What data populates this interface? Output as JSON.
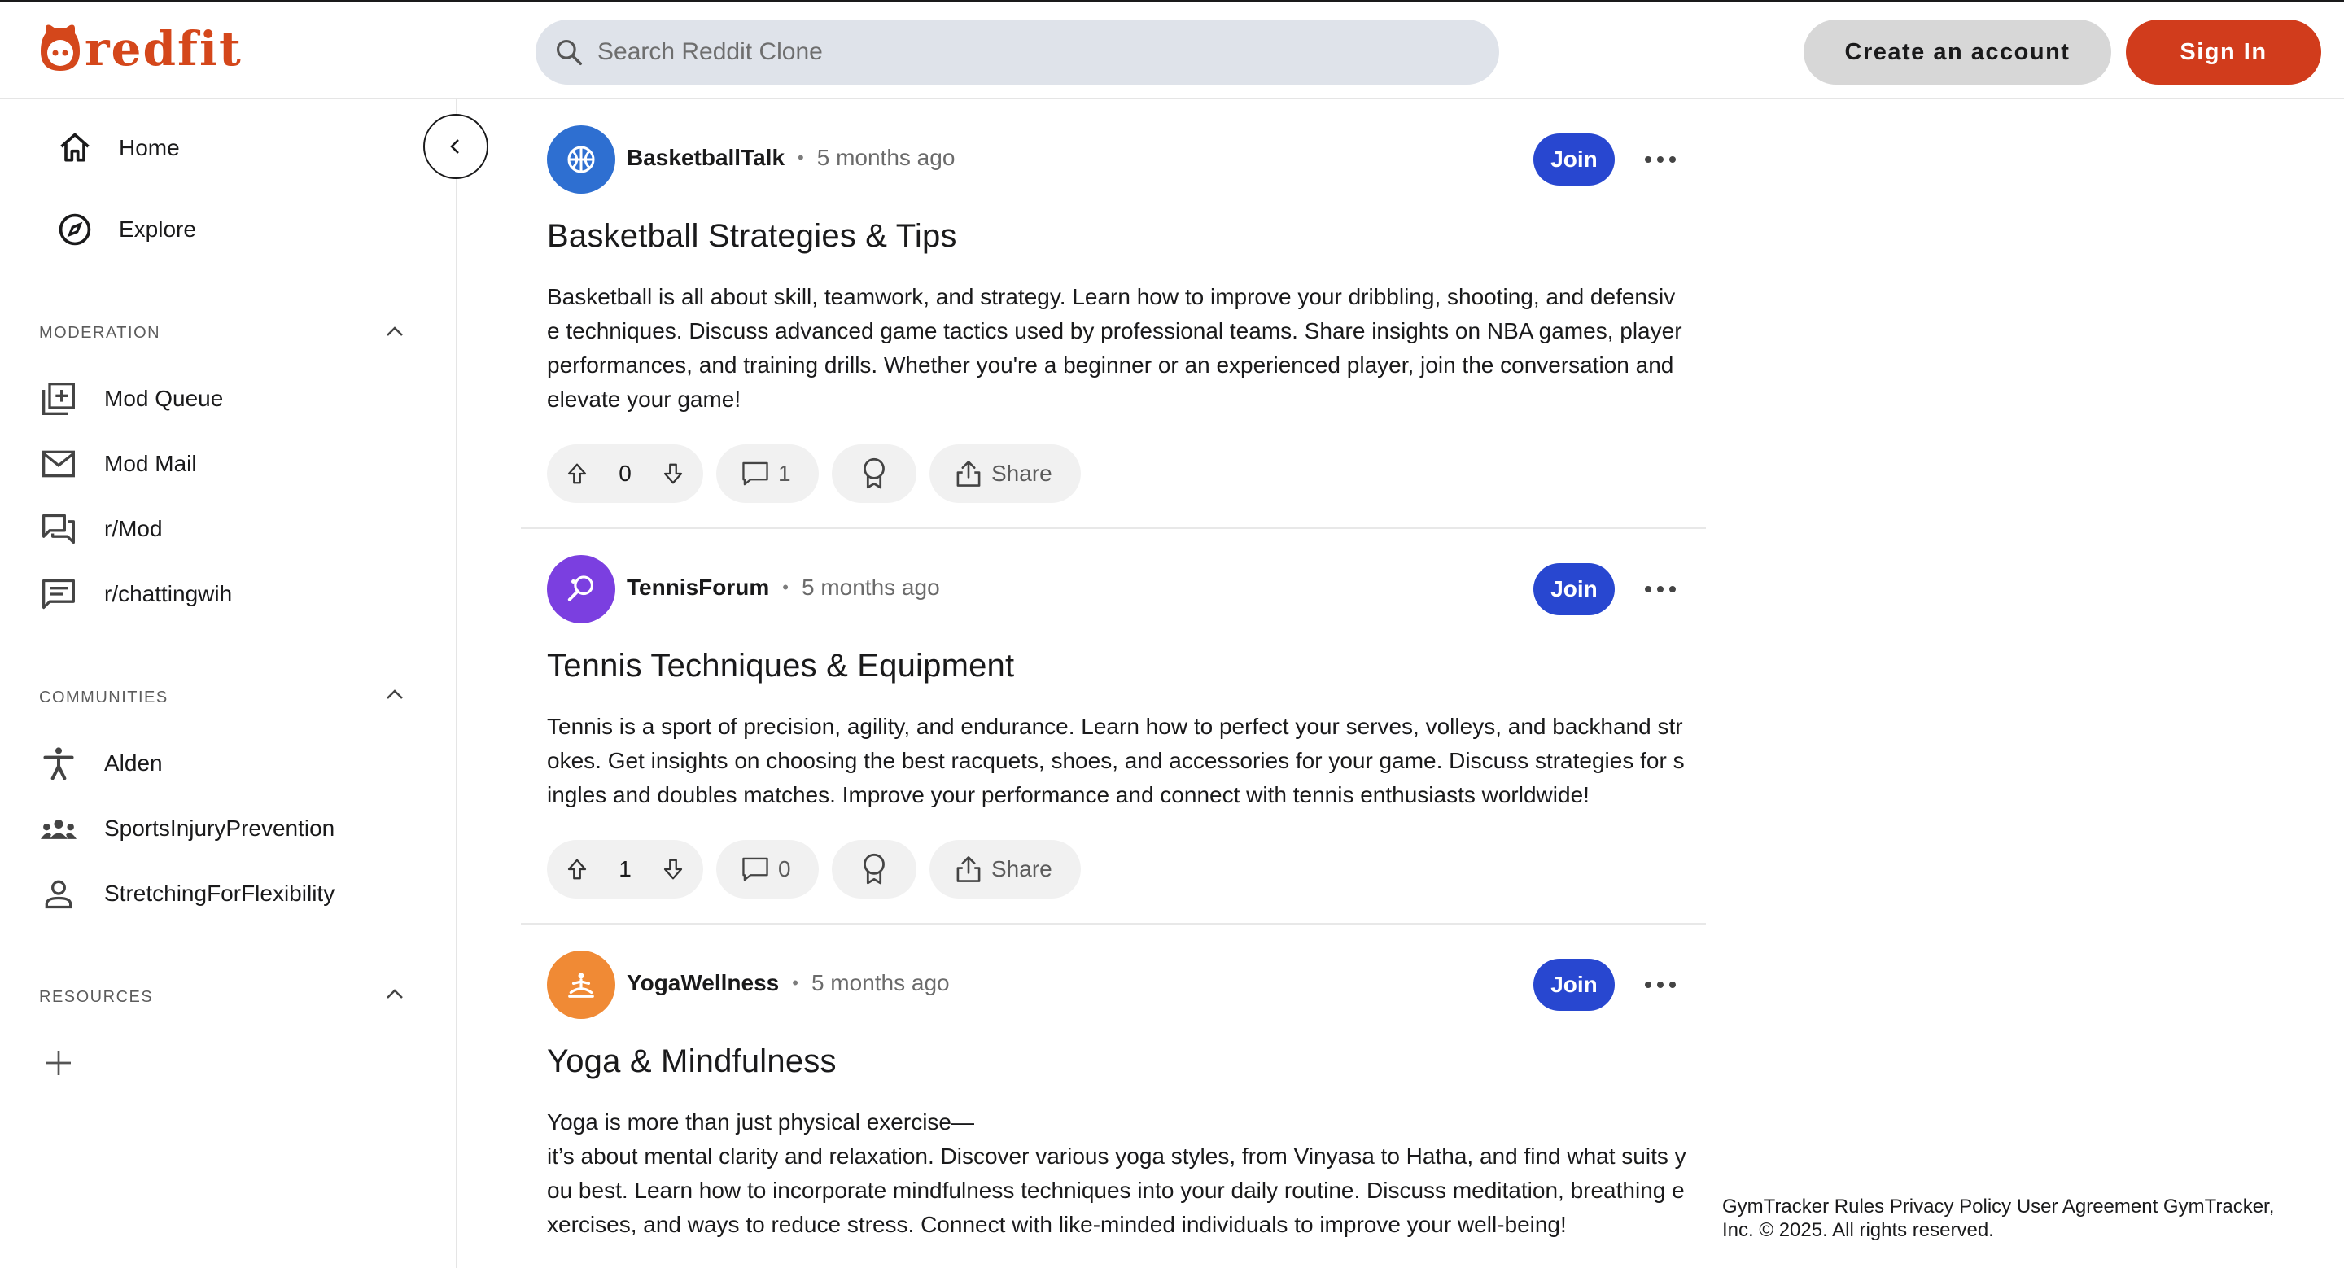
{
  "brand": {
    "name": "redfit",
    "color": "#d4471b"
  },
  "search": {
    "placeholder": "Search Reddit Clone"
  },
  "header": {
    "create_account": "Create an account",
    "sign_in": "Sign In"
  },
  "nav": [
    {
      "label": "Home",
      "icon": "home-icon"
    },
    {
      "label": "Explore",
      "icon": "compass-icon"
    }
  ],
  "moderation": {
    "title": "MODERATION",
    "items": [
      {
        "label": "Mod Queue",
        "icon": "mod-queue-icon"
      },
      {
        "label": "Mod Mail",
        "icon": "mail-icon"
      },
      {
        "label": "r/Mod",
        "icon": "forum-icon"
      },
      {
        "label": "r/chattingwih",
        "icon": "chat-icon"
      }
    ]
  },
  "communities": {
    "title": "COMMUNITIES",
    "items": [
      {
        "label": "Alden",
        "icon": "accessibility-icon"
      },
      {
        "label": "SportsInjuryPrevention",
        "icon": "group-icon"
      },
      {
        "label": "StretchingForFlexibility",
        "icon": "person-icon"
      }
    ]
  },
  "resources": {
    "title": "RESOURCES"
  },
  "posts": [
    {
      "community": "BasketballTalk",
      "time": "5 months ago",
      "avatar_color": "#2e6fd1",
      "join": "Join",
      "title": "Basketball Strategies & Tips",
      "body": "Basketball is all about skill, teamwork, and strategy. Learn how to improve your dribbling, shooting, and defensive techniques. Discuss advanced game tactics used by professional teams. Share insights on NBA games, player performances, and training drills. Whether you're a beginner or an experienced player, join the conversation and elevate your game!",
      "votes": "0",
      "comments": "1",
      "share": "Share"
    },
    {
      "community": "TennisForum",
      "time": "5 months ago",
      "avatar_color": "#7b3fe0",
      "join": "Join",
      "title": "Tennis Techniques & Equipment",
      "body": "Tennis is a sport of precision, agility, and endurance. Learn how to perfect your serves, volleys, and backhand strokes. Get insights on choosing the best racquets, shoes, and accessories for your game. Discuss strategies for singles and doubles matches. Improve your performance and connect with tennis enthusiasts worldwide!",
      "votes": "1",
      "comments": "0",
      "share": "Share"
    },
    {
      "community": "YogaWellness",
      "time": "5 months ago",
      "avatar_color": "#f08a35",
      "join": "Join",
      "title": "Yoga & Mindfulness",
      "body_line1": "Yoga is more than just physical exercise—",
      "body": "it’s about mental clarity and relaxation. Discover various yoga styles, from Vinyasa to Hatha, and find what suits you best. Learn how to incorporate mindfulness techniques into your daily routine. Discuss meditation, breathing exercises, and ways to reduce stress. Connect with like-minded individuals to improve your well-being!"
    }
  ],
  "footer": {
    "text": "GymTracker Rules Privacy Policy User Agreement GymTracker, Inc. © 2025. All rights reserved."
  }
}
